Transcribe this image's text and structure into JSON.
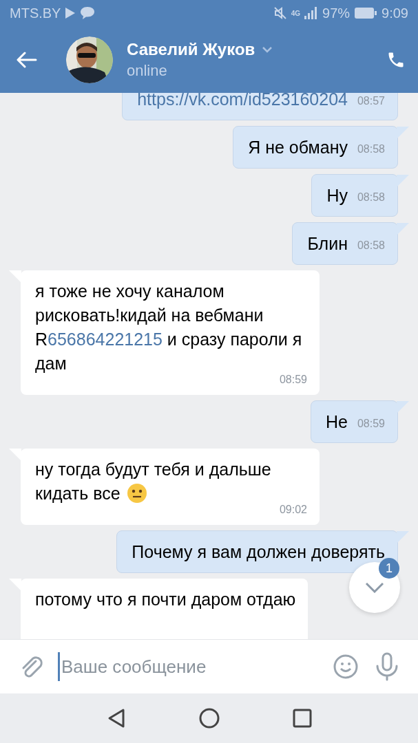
{
  "status_bar": {
    "carrier": "MTS.BY",
    "network": "4G",
    "battery": "97%",
    "time": "9:09"
  },
  "header": {
    "name": "Савелий Жуков",
    "status": "online"
  },
  "messages": [
    {
      "kind": "out",
      "parts": [
        {
          "text": "https://vk.com/id523160204",
          "link": true
        }
      ],
      "time": "08:57"
    },
    {
      "kind": "out",
      "parts": [
        {
          "text": "Я не обману",
          "link": false
        }
      ],
      "time": "08:58"
    },
    {
      "kind": "out",
      "parts": [
        {
          "text": "Ну",
          "link": false
        }
      ],
      "time": "08:58"
    },
    {
      "kind": "out",
      "parts": [
        {
          "text": "Блин",
          "link": false
        }
      ],
      "time": "08:58"
    },
    {
      "kind": "in",
      "parts": [
        {
          "text": "я тоже не хочу каналом рисковать!кидай на вебмани R",
          "link": false
        },
        {
          "text": "656864221215",
          "link": true
        },
        {
          "text": " и сразу пароли я дам",
          "link": false
        }
      ],
      "time": "08:59"
    },
    {
      "kind": "out",
      "parts": [
        {
          "text": "Не",
          "link": false
        }
      ],
      "time": "08:59"
    },
    {
      "kind": "in",
      "parts": [
        {
          "text": "ну тогда будут тебя и дальше кидать все",
          "link": false
        }
      ],
      "trailing_emoji": true,
      "time": "09:02"
    },
    {
      "kind": "out",
      "parts": [
        {
          "text": "Почему я вам должен доверять",
          "link": false
        }
      ]
    },
    {
      "kind": "in",
      "parts": [
        {
          "text": "потому что я почти даром отдаю",
          "link": false
        }
      ]
    }
  ],
  "scroll_button": {
    "badge": "1"
  },
  "composer": {
    "placeholder": "Ваше сообщение"
  }
}
